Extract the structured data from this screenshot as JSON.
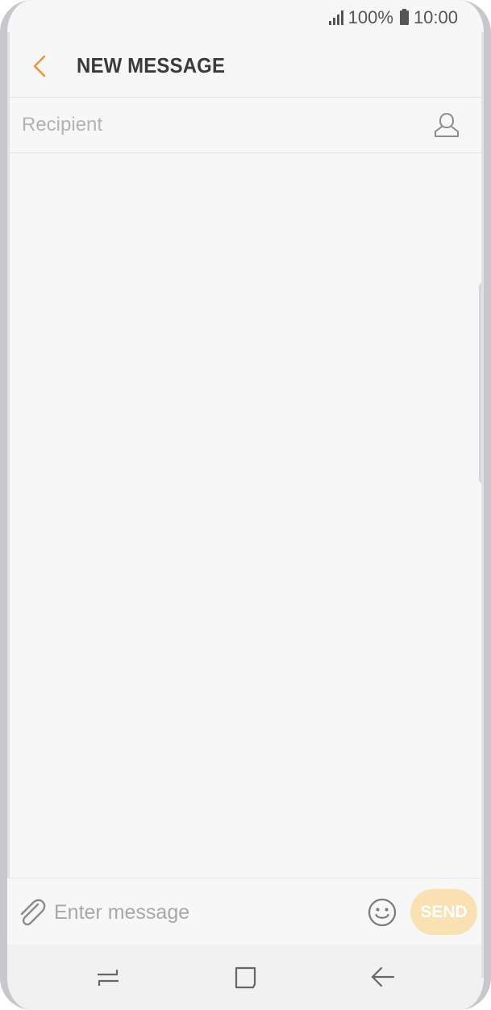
{
  "status_bar": {
    "battery": "100%",
    "time": "10:00",
    "signal_icon": "signal-icon",
    "battery_icon": "battery-icon"
  },
  "header": {
    "title": "NEW MESSAGE",
    "back_icon": "back-arrow-icon",
    "accent_color": "#e8963a"
  },
  "recipient": {
    "placeholder": "Recipient",
    "value": "",
    "contact_icon": "contact-icon"
  },
  "compose": {
    "attach_icon": "paperclip-icon",
    "placeholder": "Enter message",
    "value": "",
    "emoji_icon": "emoji-icon",
    "send_label": "SEND",
    "send_color": "#fae1b4"
  },
  "nav_bar": {
    "recents_icon": "recents-icon",
    "home_icon": "home-icon",
    "back_icon": "back-icon"
  }
}
